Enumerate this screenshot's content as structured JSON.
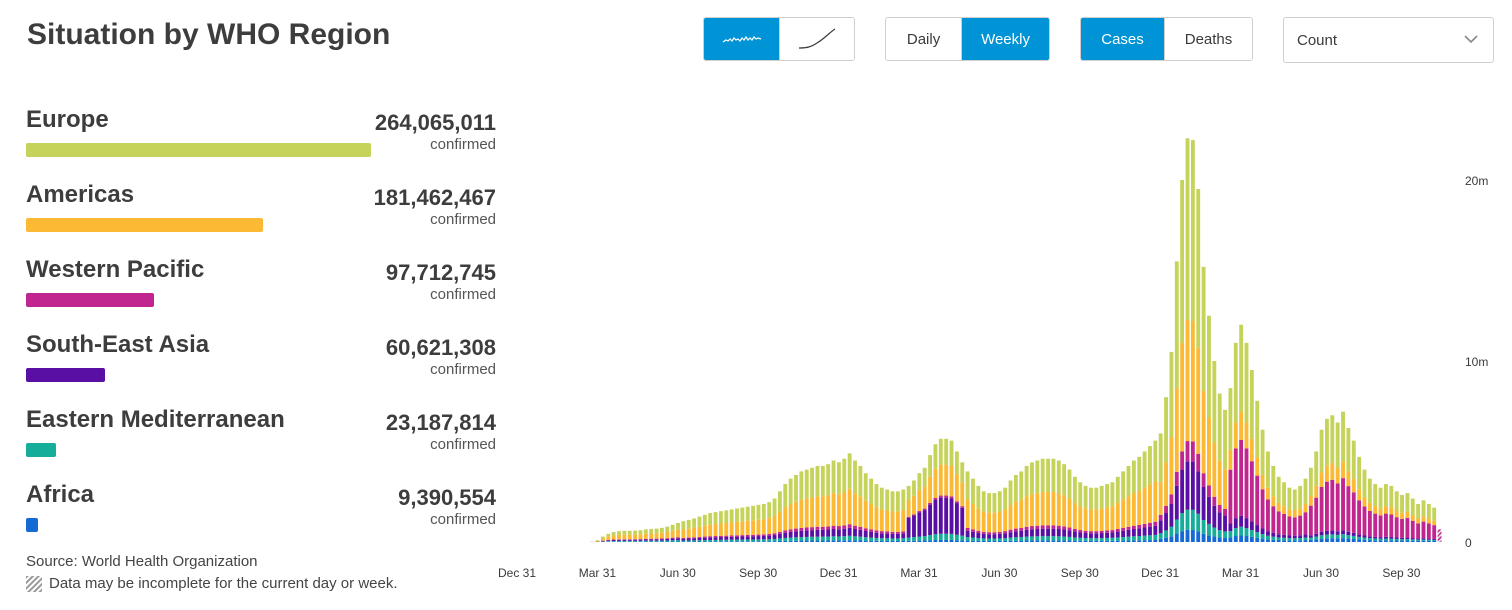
{
  "title": "Situation by WHO Region",
  "controls": {
    "daily": "Daily",
    "weekly": "Weekly",
    "cases": "Cases",
    "deaths": "Deaths",
    "metric_selected": "Count"
  },
  "colors": {
    "accent": "#0093d5",
    "europe": "#c6d35a",
    "americas": "#fbb934",
    "western_pacific": "#c1258f",
    "south_east_asia": "#5a0fa4",
    "eastern_mediterranean": "#16ad9b",
    "africa": "#1469d4"
  },
  "regions": [
    {
      "name": "Europe",
      "value": "264,065,011",
      "sub": "confirmed",
      "color": "#c6d35a",
      "count": 264065011
    },
    {
      "name": "Americas",
      "value": "181,462,467",
      "sub": "confirmed",
      "color": "#fbb934",
      "count": 181462467
    },
    {
      "name": "Western Pacific",
      "value": "97,712,745",
      "sub": "confirmed",
      "color": "#c1258f",
      "count": 97712745
    },
    {
      "name": "South-East Asia",
      "value": "60,621,308",
      "sub": "confirmed",
      "color": "#5a0fa4",
      "count": 60621308
    },
    {
      "name": "Eastern Mediterranean",
      "value": "23,187,814",
      "sub": "confirmed",
      "color": "#16ad9b",
      "count": 23187814
    },
    {
      "name": "Africa",
      "value": "9,390,554",
      "sub": "confirmed",
      "color": "#1469d4",
      "count": 9390554
    }
  ],
  "footer": {
    "source": "Source: World Health Organization",
    "note": "Data may be incomplete for the current day or week."
  },
  "chart_data": {
    "type": "bar",
    "stacked": true,
    "x_tick_labels": [
      "Dec 31",
      "Mar 31",
      "Jun 30",
      "Sep 30",
      "Dec 31",
      "Mar 31",
      "Jun 30",
      "Sep 30",
      "Dec 31",
      "Mar 31",
      "Jun 30",
      "Sep 30"
    ],
    "y_tick_labels": [
      "0",
      "10m",
      "20m"
    ],
    "ylim": [
      0,
      23200000
    ],
    "series_order": [
      "Africa",
      "Eastern Mediterranean",
      "South-East Asia",
      "Western Pacific",
      "Americas",
      "Europe"
    ],
    "total_weekly_cases_millions": [
      0.0,
      0.0,
      0.0,
      0.0,
      0.0,
      0.0,
      0.0,
      0.0,
      0.0,
      0.02,
      0.1,
      0.3,
      0.45,
      0.55,
      0.6,
      0.62,
      0.62,
      0.63,
      0.65,
      0.7,
      0.72,
      0.74,
      0.78,
      0.85,
      0.95,
      1.05,
      1.15,
      1.22,
      1.3,
      1.4,
      1.5,
      1.6,
      1.65,
      1.7,
      1.75,
      1.8,
      1.85,
      1.9,
      1.95,
      2.0,
      2.05,
      2.1,
      2.2,
      2.4,
      2.8,
      3.2,
      3.5,
      3.7,
      3.9,
      4.0,
      4.1,
      4.2,
      4.2,
      4.3,
      4.5,
      4.4,
      4.6,
      4.9,
      4.5,
      4.2,
      3.8,
      3.5,
      3.2,
      3.0,
      2.9,
      2.8,
      2.8,
      2.9,
      3.1,
      3.4,
      3.8,
      4.1,
      4.8,
      5.4,
      5.7,
      5.7,
      5.6,
      5.0,
      4.4,
      3.9,
      3.5,
      3.1,
      2.8,
      2.7,
      2.7,
      2.8,
      3.0,
      3.4,
      3.7,
      3.9,
      4.2,
      4.4,
      4.5,
      4.6,
      4.6,
      4.6,
      4.5,
      4.3,
      4.0,
      3.6,
      3.3,
      3.1,
      3.0,
      3.0,
      3.1,
      3.2,
      3.3,
      3.6,
      3.9,
      4.2,
      4.5,
      4.7,
      5.0,
      5.3,
      5.6,
      6.0,
      8.0,
      10.5,
      15.5,
      20.0,
      22.3,
      22.2,
      19.5,
      15.2,
      12.5,
      10.0,
      8.2,
      7.3,
      8.5,
      11.0,
      12.0,
      11.0,
      9.5,
      7.8,
      6.2,
      5.0,
      4.2,
      3.6,
      3.3,
      3.0,
      2.9,
      3.1,
      3.5,
      4.1,
      5.0,
      6.2,
      6.8,
      7.0,
      6.6,
      7.2,
      6.3,
      5.6,
      4.7,
      4.0,
      3.5,
      3.2,
      3.0,
      3.2,
      3.1,
      2.8,
      2.6,
      2.7,
      2.4,
      2.1,
      2.3,
      2.1,
      1.9,
      0.7
    ]
  }
}
